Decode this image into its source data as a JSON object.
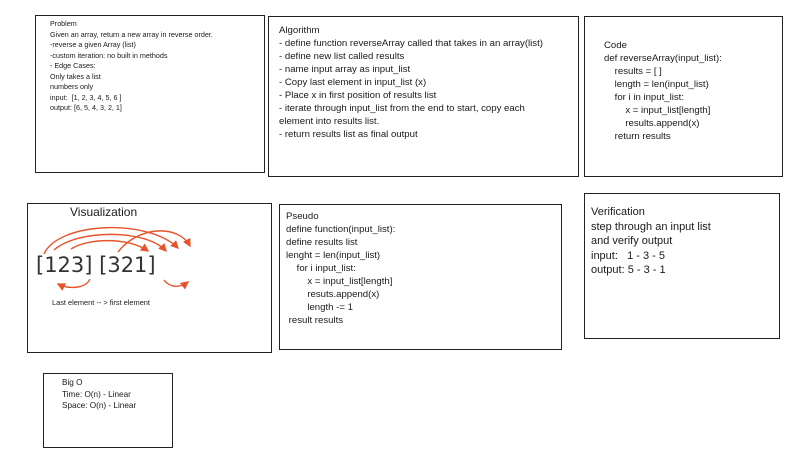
{
  "problem": {
    "lines": [
      "Problem",
      "",
      "Given an array, return a new array in reverse order.",
      "",
      "-reverse a given Array (list)",
      "-custom iteration: no built in methods",
      "",
      "- Edge Cases:",
      "Only takes a list",
      "numbers only",
      "",
      "",
      "",
      "input:  [1, 2, 3, 4, 5, 6 ]",
      "output: [6, 5, 4, 3, 2, 1]"
    ]
  },
  "algorithm": {
    "lines": [
      "Algorithm",
      "",
      "",
      "- define function reverseArray called that takes in an array(list)",
      "- define new list called results",
      "- name input array as input_list",
      "- Copy last element in input_list (x)",
      "- Place x in first position of results list",
      "- iterate through input_list from the end to start, copy each",
      "element into results list.",
      "- return results list as final output"
    ]
  },
  "code": {
    "lines": [
      "Code",
      "",
      "def reverseArray(input_list):",
      "    results = [ ]",
      "    length = len(input_list)",
      "    for i in input_list:",
      "        x = input_list[length]",
      "        results.append(x)",
      "    return results"
    ]
  },
  "visualization": {
    "title": "Visualization",
    "handwriting": "[123] [321]",
    "note": "Last element -- > first element",
    "arrow_color": "#e8542a"
  },
  "pseudo": {
    "lines": [
      "Pseudo",
      "define function(input_list):",
      "define results list",
      "",
      "lenght = len(input_list)",
      "    for i input_list:",
      "        x = input_list[length]",
      "        resuts.append(x)",
      "        length -= 1",
      " result results"
    ]
  },
  "verification": {
    "lines": [
      "Verification",
      "",
      "step through an input list",
      "and verify output",
      "",
      "",
      "",
      "input:   1 - 3 - 5",
      "output: 5 - 3 - 1"
    ]
  },
  "bigo": {
    "lines": [
      "Big O",
      "",
      "Time: O(n) - Linear",
      "Space: O(n) - Linear"
    ]
  }
}
